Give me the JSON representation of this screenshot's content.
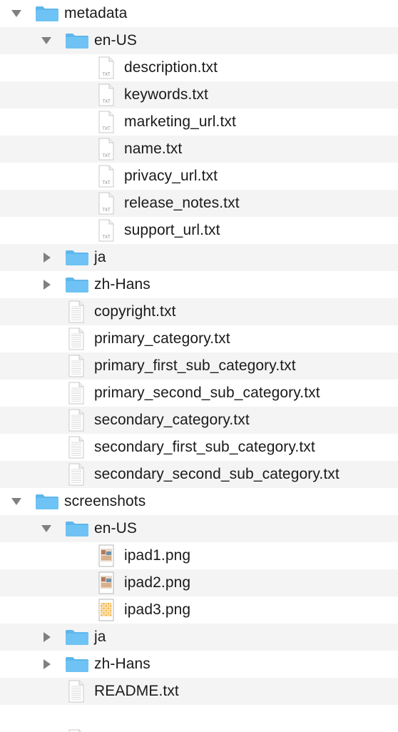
{
  "rows": [
    {
      "level": 0,
      "kind": "folder",
      "expanded": true,
      "label": "metadata"
    },
    {
      "level": 1,
      "kind": "folder",
      "expanded": true,
      "label": "en-US"
    },
    {
      "level": 2,
      "kind": "txt",
      "label": "description.txt"
    },
    {
      "level": 2,
      "kind": "txt",
      "label": "keywords.txt"
    },
    {
      "level": 2,
      "kind": "txt",
      "label": "marketing_url.txt"
    },
    {
      "level": 2,
      "kind": "txt",
      "label": "name.txt"
    },
    {
      "level": 2,
      "kind": "txt",
      "label": "privacy_url.txt"
    },
    {
      "level": 2,
      "kind": "txt",
      "label": "release_notes.txt"
    },
    {
      "level": 2,
      "kind": "txt",
      "label": "support_url.txt"
    },
    {
      "level": 1,
      "kind": "folder",
      "expanded": false,
      "label": "ja"
    },
    {
      "level": 1,
      "kind": "folder",
      "expanded": false,
      "label": "zh-Hans"
    },
    {
      "level": 1,
      "kind": "doc",
      "label": "copyright.txt"
    },
    {
      "level": 1,
      "kind": "doc",
      "label": "primary_category.txt"
    },
    {
      "level": 1,
      "kind": "doc",
      "label": "primary_first_sub_category.txt"
    },
    {
      "level": 1,
      "kind": "doc",
      "label": "primary_second_sub_category.txt"
    },
    {
      "level": 1,
      "kind": "doc",
      "label": "secondary_category.txt"
    },
    {
      "level": 1,
      "kind": "doc",
      "label": "secondary_first_sub_category.txt"
    },
    {
      "level": 1,
      "kind": "doc",
      "label": "secondary_second_sub_category.txt"
    },
    {
      "level": 0,
      "kind": "folder",
      "expanded": true,
      "label": "screenshots"
    },
    {
      "level": 1,
      "kind": "folder",
      "expanded": true,
      "label": "en-US"
    },
    {
      "level": 2,
      "kind": "image",
      "label": "ipad1.png"
    },
    {
      "level": 2,
      "kind": "image",
      "label": "ipad2.png"
    },
    {
      "level": 2,
      "kind": "image-grid",
      "label": "ipad3.png"
    },
    {
      "level": 1,
      "kind": "folder",
      "expanded": false,
      "label": "ja"
    },
    {
      "level": 1,
      "kind": "folder",
      "expanded": false,
      "label": "zh-Hans"
    },
    {
      "level": 1,
      "kind": "doc",
      "label": "README.txt"
    },
    {
      "level": 1,
      "kind": "empty",
      "label": ""
    }
  ],
  "colors": {
    "folder": "#6ec3f4",
    "folder_tab": "#5fb6ea",
    "row_alt": "#f4f4f5",
    "disclosure": "#808080",
    "text": "#1a1a1a"
  }
}
